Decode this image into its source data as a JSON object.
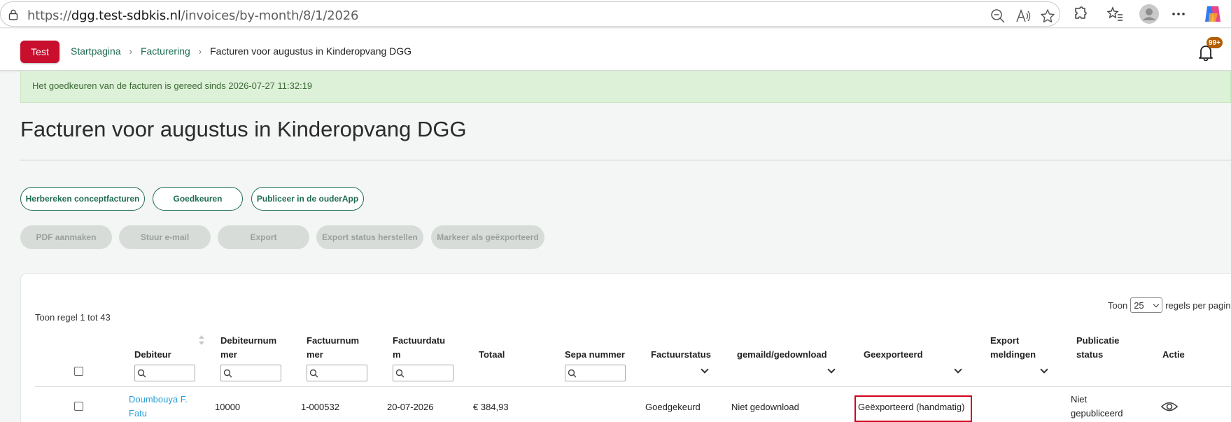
{
  "browser": {
    "url_prefix": "https://",
    "url_host": "dgg.test-sdbkis.nl",
    "url_path": "/invoices/by-month/8/1/2026",
    "icons": [
      "lock-icon",
      "zoom-out-icon",
      "read-aloud-icon",
      "favorite-star-icon",
      "extensions-icon",
      "favorites-icon",
      "profile-avatar",
      "more-menu-icon",
      "copilot-icon"
    ]
  },
  "header": {
    "env_badge": "Test",
    "breadcrumbs": [
      "Startpagina",
      "Facturering"
    ],
    "current": "Facturen voor augustus in Kinderopvang DGG",
    "notification_count": "99+"
  },
  "alert": {
    "text": "Het goedkeuren van de facturen is gereed sinds 2026-07-27 11:32:19"
  },
  "page": {
    "title": "Facturen voor augustus in Kinderopvang DGG"
  },
  "actions": {
    "primary": [
      "Herbereken conceptfacturen",
      "Goedkeuren",
      "Publiceer in de ouderApp"
    ],
    "disabled": [
      "PDF aanmaken",
      "Stuur e-mail",
      "Export",
      "Export status herstellen",
      "Markeer als geëxporteerd"
    ]
  },
  "table": {
    "info": "Toon regel 1 tot 43",
    "per_page_prefix": "Toon",
    "per_page_value": "25",
    "per_page_suffix": "regels per pagina",
    "headers": {
      "debiteur": "Debiteur",
      "debiteurnummer": "Debiteurnum\nmer",
      "factuurnummer": "Factuurnum\nmer",
      "factuurdatum": "Factuurdatu\nm",
      "totaal": "Totaal",
      "sepa": "Sepa nummer",
      "factuurstatus": "Factuurstatus",
      "gemaild": "gemaild/gedownload",
      "geexporteerd": "Geexporteerd",
      "export_meldingen": "Export\nmeldingen",
      "publicatie": "Publicatie\nstatus",
      "actie": "Actie"
    },
    "rows": [
      {
        "debiteur": "Doumbouya F.\nFatu",
        "debiteurnummer": "10000",
        "factuurnummer": "1-000532",
        "factuurdatum": "20-07-2026",
        "totaal": "€ 384,93",
        "factuurstatus": "Goedgekeurd",
        "gemaild": "Niet gedownload",
        "geexporteerd": "Geëxporteerd (handmatig)",
        "publicatie": "Niet\ngepubliceerd"
      }
    ]
  },
  "colors": {
    "brand_green": "#1e6b52",
    "alert_bg": "#ddf0d8",
    "env_red": "#c8102e",
    "link_blue": "#2a9fd6",
    "highlight_red": "#d0021b"
  }
}
